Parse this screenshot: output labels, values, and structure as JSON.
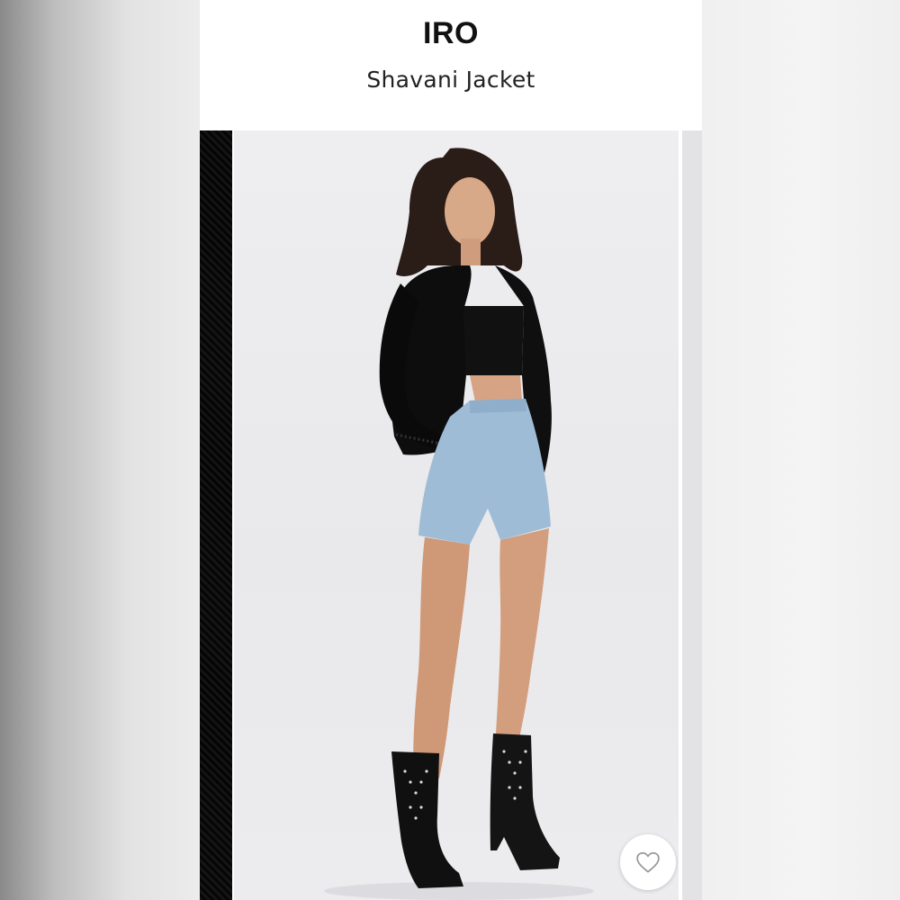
{
  "product": {
    "brand": "IRO",
    "name": "Shavani Jacket"
  },
  "gallery": {
    "favorite_icon": "heart-outline-icon"
  },
  "colors": {
    "header_background": "#ffffff",
    "brand_text": "#111111",
    "jacket": "#0d0d0d",
    "denim": "#9fbcd6"
  }
}
